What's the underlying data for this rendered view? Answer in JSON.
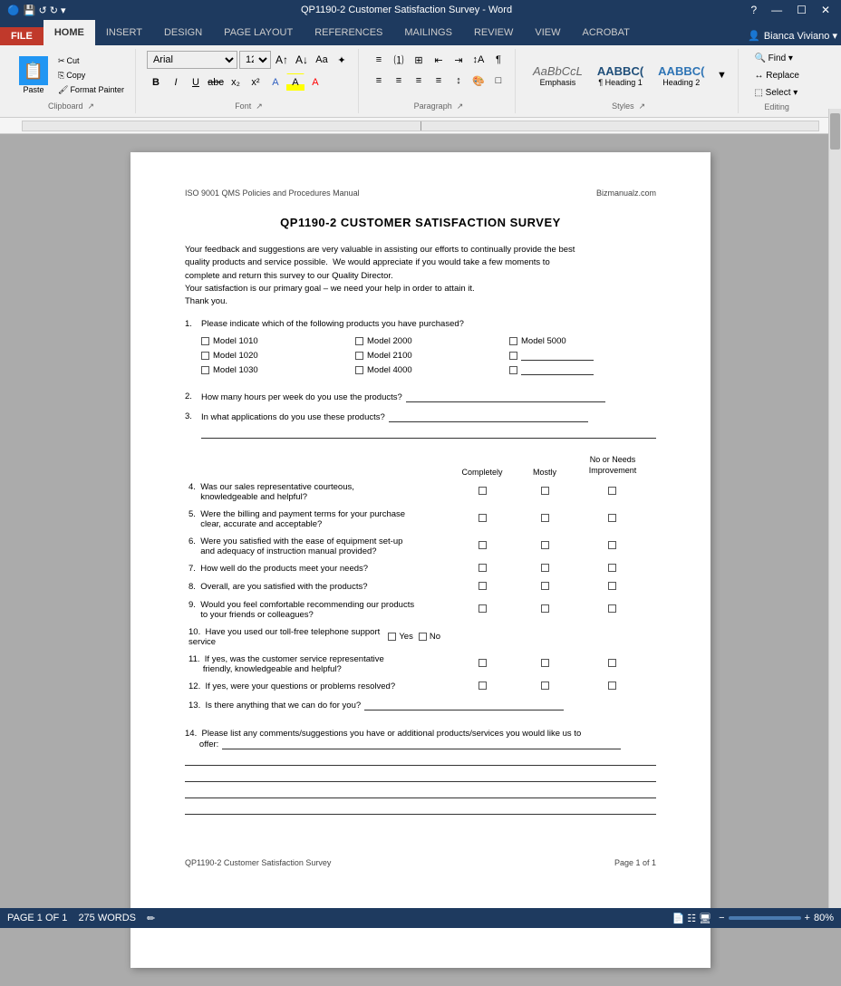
{
  "titleBar": {
    "title": "QP1190-2 Customer Satisfaction Survey - Word",
    "controls": [
      "?",
      "—",
      "☐",
      "✕"
    ]
  },
  "ribbon": {
    "tabs": [
      "FILE",
      "HOME",
      "INSERT",
      "DESIGN",
      "PAGE LAYOUT",
      "REFERENCES",
      "MAILINGS",
      "REVIEW",
      "VIEW",
      "ACROBAT"
    ],
    "activeTab": "HOME",
    "groups": {
      "clipboard": {
        "label": "Clipboard",
        "buttons": [
          "Paste",
          "Cut",
          "Copy",
          "Format Painter"
        ]
      },
      "font": {
        "label": "Font",
        "fontName": "Arial",
        "fontSize": "12",
        "buttons": [
          "B",
          "I",
          "U",
          "abc",
          "x₂",
          "x²",
          "A",
          "A"
        ]
      },
      "paragraph": {
        "label": "Paragraph"
      },
      "styles": {
        "label": "Styles",
        "items": [
          "Emphasis",
          "¶ Heading 1",
          "Heading 2"
        ]
      },
      "editing": {
        "label": "Editing",
        "buttons": [
          "Find ▾",
          "Replace",
          "Select ▾"
        ]
      }
    }
  },
  "document": {
    "header": {
      "left": "ISO 9001 QMS Policies and Procedures Manual",
      "right": "Bizmanualz.com"
    },
    "title": "QP1190-2 CUSTOMER SATISFACTION SURVEY",
    "intro": [
      "Your feedback and suggestions are very valuable in assisting our efforts to continually provide the best",
      "quality products and service possible.  We would appreciate if you would take a few moments to",
      "complete and return this survey to our Quality Director.",
      "Your satisfaction is our primary goal – we need your help in order to attain it.",
      "Thank you."
    ],
    "questions": [
      {
        "num": "1.",
        "text": "Please indicate which of the following products you have purchased?",
        "type": "models"
      },
      {
        "num": "2.",
        "text": "How many hours per week do you use the products?",
        "type": "underline"
      },
      {
        "num": "3.",
        "text": "In what applications do you use these products?",
        "type": "underline-multi"
      }
    ],
    "models": [
      [
        "Model 1010",
        "Model 2000",
        "Model 5000"
      ],
      [
        "Model 1020",
        "Model 2100",
        ""
      ],
      [
        "Model 1030",
        "Model 4000",
        ""
      ]
    ],
    "ratingHeader": {
      "col1": "",
      "col2": "Completely",
      "col3": "Mostly",
      "col4": "No or Needs\nImprovement"
    },
    "ratingQuestions": [
      {
        "num": "4.",
        "text": "Was our sales representative courteous, knowledgeable and helpful?"
      },
      {
        "num": "5.",
        "text": "Were the billing and payment terms for your purchase clear, accurate and acceptable?"
      },
      {
        "num": "6.",
        "text": "Were you satisfied with the ease of equipment set-up and adequacy of instruction manual provided?"
      },
      {
        "num": "7.",
        "text": "How well do the products meet your needs?"
      },
      {
        "num": "8.",
        "text": "Overall, are you satisfied with the products?"
      },
      {
        "num": "9.",
        "text": "Would you feel comfortable recommending our products to your friends or colleagues?"
      },
      {
        "num": "10.",
        "text": "Have you used our toll-free telephone support service",
        "type": "yes-no"
      },
      {
        "num": "11.",
        "text": "If yes, was the customer service representative friendly, knowledgeable and helpful?"
      },
      {
        "num": "12.",
        "text": "If yes, were your questions or problems resolved?"
      },
      {
        "num": "13.",
        "text": "Is there anything that we can do for you?",
        "type": "underline"
      }
    ],
    "lastQuestion": {
      "num": "14.",
      "text": "Please list any comments/suggestions you have or additional products/services you would like us to offer:"
    },
    "footer": {
      "left": "QP1190-2 Customer Satisfaction Survey",
      "right": "Page 1 of 1"
    }
  },
  "statusBar": {
    "left": [
      "PAGE 1 OF 1",
      "275 WORDS"
    ],
    "zoom": "80%"
  }
}
